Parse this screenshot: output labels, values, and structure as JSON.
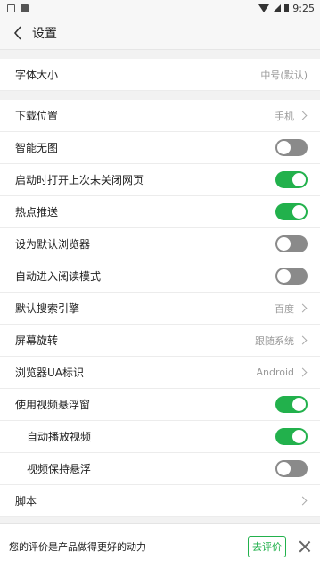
{
  "status_bar": {
    "time": "9:25",
    "left_icons": [
      "image-icon",
      "a-icon"
    ],
    "right_icons": [
      "wifi-icon",
      "signal-icon",
      "battery-icon"
    ]
  },
  "header": {
    "title": "设置",
    "back_icon": "chevron-left-icon"
  },
  "groups": [
    {
      "rows": [
        {
          "label": "字体大小",
          "value": "中号(默认)",
          "type": "value"
        }
      ]
    },
    {
      "rows": [
        {
          "label": "下载位置",
          "value": "手机",
          "type": "link"
        },
        {
          "label": "智能无图",
          "type": "toggle",
          "on": false
        },
        {
          "label": "启动时打开上次未关闭网页",
          "type": "toggle",
          "on": true
        },
        {
          "label": "热点推送",
          "type": "toggle",
          "on": true
        },
        {
          "label": "设为默认浏览器",
          "type": "toggle",
          "on": false
        },
        {
          "label": "自动进入阅读模式",
          "type": "toggle",
          "on": false
        },
        {
          "label": "默认搜索引擎",
          "value": "百度",
          "type": "link"
        },
        {
          "label": "屏幕旋转",
          "value": "跟随系统",
          "type": "link"
        },
        {
          "label": "浏览器UA标识",
          "value": "Android",
          "type": "link"
        },
        {
          "label": "使用视频悬浮窗",
          "type": "toggle",
          "on": true
        },
        {
          "label": "自动播放视频",
          "type": "toggle",
          "on": true,
          "sub": true
        },
        {
          "label": "视频保持悬浮",
          "type": "toggle",
          "on": false,
          "sub": true
        },
        {
          "label": "脚本",
          "value": "",
          "type": "link"
        }
      ]
    }
  ],
  "bottom_bar": {
    "text": "您的评价是产品做得更好的动力",
    "rate_label": "去评价"
  },
  "colors": {
    "accent": "#22b14c",
    "toggle_off": "#8a8a8a"
  }
}
